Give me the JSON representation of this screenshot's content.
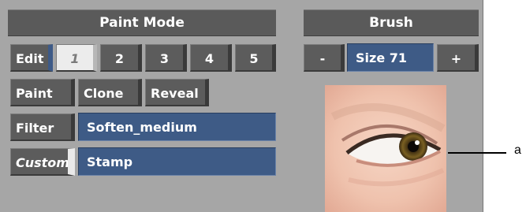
{
  "paint_mode": {
    "header": "Paint Mode",
    "edit_label": "Edit",
    "slots": [
      "1",
      "2",
      "3",
      "4",
      "5"
    ],
    "active_slot": "1",
    "paint_label": "Paint",
    "clone_label": "Clone",
    "reveal_label": "Reveal",
    "filter_label": "Filter",
    "filter_value": "Soften_medium",
    "custom_label": "Custom",
    "custom_value": "Stamp"
  },
  "brush": {
    "header": "Brush",
    "decrease_label": "-",
    "size_value": "Size 71",
    "increase_label": "+"
  },
  "callout": {
    "label": "a"
  },
  "colors": {
    "panel_bg": "#a6a6a6",
    "button_bg": "#5c5c5c",
    "field_blue": "#3e5b86",
    "active_slot_bg": "#ececec"
  }
}
